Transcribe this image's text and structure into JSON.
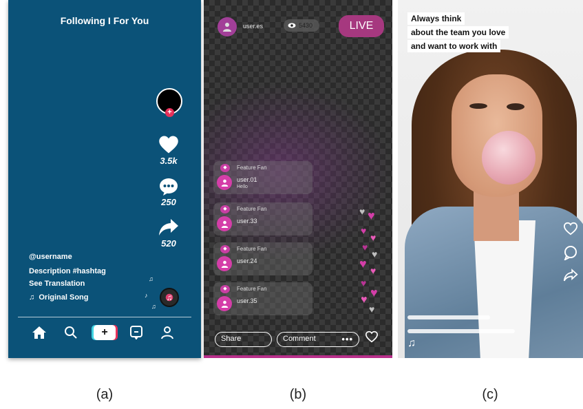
{
  "panel_a": {
    "header": "Following I For You",
    "likes": "3.5k",
    "comments": "250",
    "shares": "520",
    "username": "@username",
    "description": "Description #hashtag",
    "translation": "See Translation",
    "song": "Original Song",
    "nav_icons": [
      "home-icon",
      "search-icon",
      "create-icon",
      "inbox-icon",
      "profile-icon"
    ]
  },
  "panel_b": {
    "top_username": "user.es",
    "viewer_count": "5430",
    "live_label": "LIVE",
    "messages": [
      {
        "badge": "Feature Fan",
        "user": "user.01",
        "text": "Hello"
      },
      {
        "badge": "Feature Fan",
        "user": "user.33",
        "text": ""
      },
      {
        "badge": "Feature Fan",
        "user": "user.24",
        "text": ""
      },
      {
        "badge": "Feature Fan",
        "user": "user.35",
        "text": ""
      }
    ],
    "share_label": "Share",
    "comment_label": "Comment",
    "more_label": "•••"
  },
  "panel_c": {
    "caption_lines": [
      "Always think",
      "about the team you love",
      "and want to work with"
    ]
  },
  "captions": [
    "(a)",
    "(b)",
    "(c)"
  ],
  "colors": {
    "panel_a_bg": "#0b5278",
    "live_pink": "#a6387f",
    "heart_pink": "#d43ea8"
  }
}
